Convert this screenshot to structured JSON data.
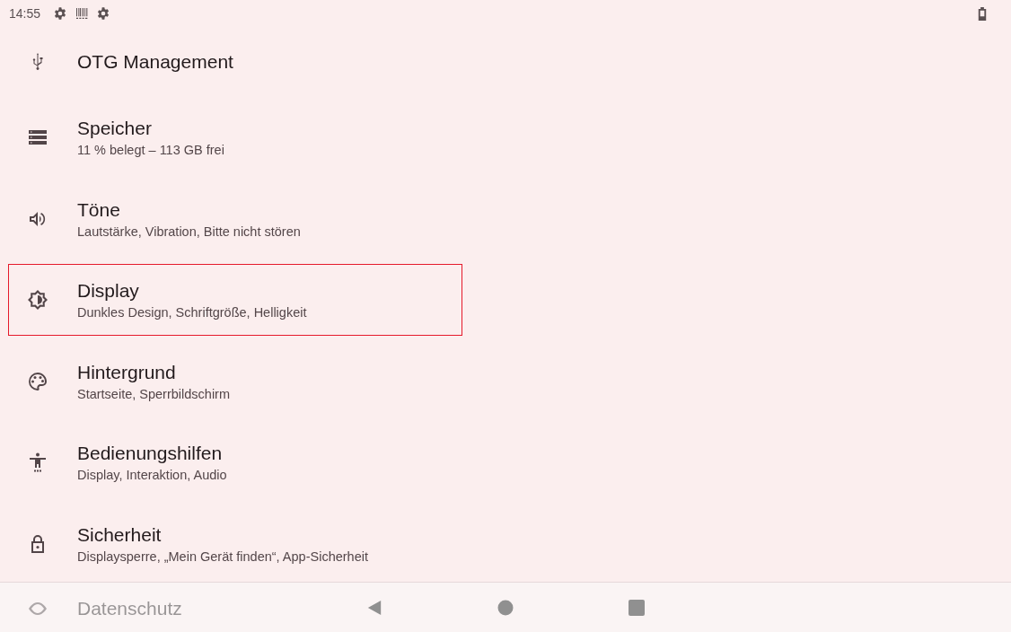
{
  "status_bar": {
    "time": "14:55"
  },
  "settings": [
    {
      "kind": "usb",
      "title": "OTG Management",
      "highlighted": false
    },
    {
      "kind": "storage",
      "title": "Speicher",
      "subtitle": "11 % belegt – 113 GB frei",
      "highlighted": false
    },
    {
      "kind": "sound",
      "title": "Töne",
      "subtitle": "Lautstärke, Vibration, Bitte nicht stören",
      "highlighted": false
    },
    {
      "kind": "display",
      "title": "Display",
      "subtitle": "Dunkles Design, Schriftgröße, Helligkeit",
      "highlighted": true
    },
    {
      "kind": "palette",
      "title": "Hintergrund",
      "subtitle": "Startseite, Sperrbildschirm",
      "highlighted": false
    },
    {
      "kind": "accessibility",
      "title": "Bedienungshilfen",
      "subtitle": "Display, Interaktion, Audio",
      "highlighted": false
    },
    {
      "kind": "lock",
      "title": "Sicherheit",
      "subtitle": "Displaysperre, „Mein Gerät finden“, App-Sicherheit",
      "highlighted": false
    },
    {
      "kind": "privacy",
      "title": "Datenschutz",
      "highlighted": false
    }
  ]
}
